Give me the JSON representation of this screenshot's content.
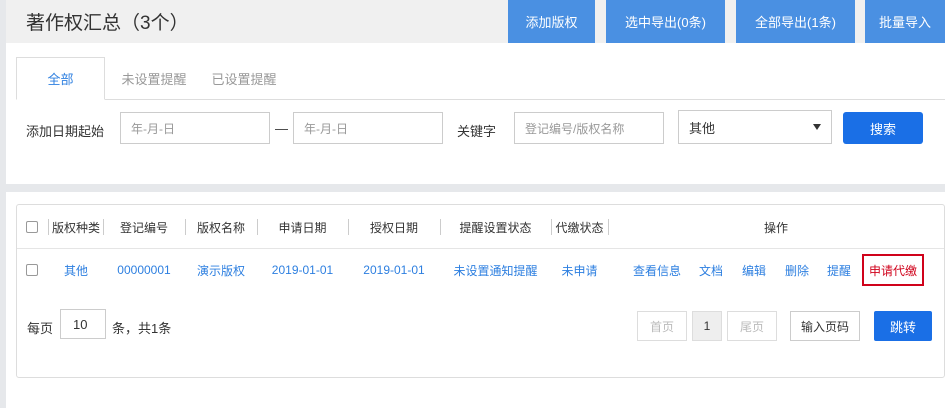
{
  "header": {
    "title": "著作权汇总（3个）",
    "buttons": [
      "添加版权",
      "选中导出(0条)",
      "全部导出(1条)",
      "批量导入"
    ]
  },
  "tabs": [
    {
      "label": "全部",
      "active": true
    },
    {
      "label": "未设置提醒",
      "active": false
    },
    {
      "label": "已设置提醒",
      "active": false
    }
  ],
  "filter": {
    "date_label": "添加日期起始",
    "date_start_placeholder": "年-月-日",
    "date_separator": "—",
    "date_end_placeholder": "年-月-日",
    "keyword_label": "关键字",
    "keyword_placeholder": "登记编号/版权名称",
    "select_value": "其他",
    "search_button": "搜索"
  },
  "table": {
    "columns": [
      "版权种类",
      "登记编号",
      "版权名称",
      "申请日期",
      "授权日期",
      "提醒设置状态",
      "代缴状态",
      "操作"
    ],
    "rows": [
      {
        "type": "其他",
        "reg_no": "00000001",
        "name": "演示版权",
        "apply_date": "2019-01-01",
        "auth_date": "2019-01-01",
        "remind_status": "未设置通知提醒",
        "pay_status": "未申请",
        "actions": [
          "查看信息",
          "文档",
          "编辑",
          "删除",
          "提醒",
          "申请代缴"
        ]
      }
    ]
  },
  "pager": {
    "per_page_label": "每页",
    "per_page_value": "10",
    "total_text": "条，共1条",
    "first": "首页",
    "current": "1",
    "last": "尾页",
    "jump_placeholder": "输入页码",
    "jump_button": "跳转"
  },
  "colors": {
    "accent": "#1a6fe6",
    "header_button": "#4a90e2",
    "link": "#2d7fe0",
    "danger": "#d0021b"
  }
}
